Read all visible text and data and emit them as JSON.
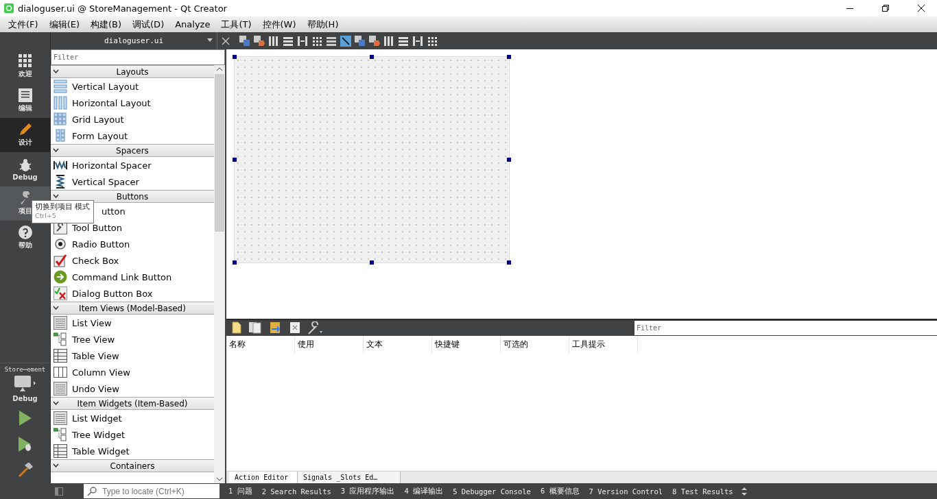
{
  "window": {
    "title": "dialoguser.ui @ StoreManagement - Qt Creator"
  },
  "menu": [
    "文件(F)",
    "编辑(E)",
    "构建(B)",
    "调试(D)",
    "Analyze",
    "工具(T)",
    "控件(W)",
    "帮助(H)"
  ],
  "editor_bar": {
    "file": "dialoguser.ui"
  },
  "modes": [
    {
      "label": "欢迎",
      "selected": false,
      "hovered": false
    },
    {
      "label": "编辑",
      "selected": false,
      "hovered": false
    },
    {
      "label": "设计",
      "selected": true,
      "hovered": false
    },
    {
      "label": "Debug",
      "selected": false,
      "hovered": false
    },
    {
      "label": "项目",
      "selected": false,
      "hovered": true
    },
    {
      "label": "帮助",
      "selected": false,
      "hovered": false
    }
  ],
  "target": {
    "project": "Store⋯ement",
    "config": "Debug"
  },
  "tooltip": {
    "title": "切换到项目 模式",
    "shortcut": "Ctrl+5"
  },
  "widget_box": {
    "filter_placeholder": "Filter",
    "groups": [
      {
        "title": "Layouts",
        "items": [
          {
            "label": "Vertical Layout"
          },
          {
            "label": "Horizontal Layout"
          },
          {
            "label": "Grid Layout"
          },
          {
            "label": "Form Layout"
          }
        ]
      },
      {
        "title": "Spacers",
        "items": [
          {
            "label": "Horizontal Spacer"
          },
          {
            "label": "Vertical Spacer"
          }
        ]
      },
      {
        "title": "Buttons",
        "items": [
          {
            "label": "utton",
            "kind": "covered"
          },
          {
            "label": "Tool Button"
          },
          {
            "label": "Radio Button"
          },
          {
            "label": "Check Box"
          },
          {
            "label": "Command Link Button"
          },
          {
            "label": "Dialog Button Box"
          }
        ]
      },
      {
        "title": "Item Views (Model-Based)",
        "items": [
          {
            "label": "List View"
          },
          {
            "label": "Tree View"
          },
          {
            "label": "Table View"
          },
          {
            "label": "Column View"
          },
          {
            "label": "Undo View"
          }
        ]
      },
      {
        "title": "Item Widgets (Item-Based)",
        "items": [
          {
            "label": "List Widget"
          },
          {
            "label": "Tree Widget"
          },
          {
            "label": "Table Widget"
          }
        ]
      },
      {
        "title": "Containers"
      }
    ]
  },
  "action_editor": {
    "filter_placeholder": "Filter",
    "columns": [
      "名称",
      "使用",
      "文本",
      "快捷键",
      "可选的",
      "工具提示"
    ],
    "tabs": [
      {
        "label": "Action Editor",
        "selected": true
      },
      {
        "label": "Signals _Slots Ed…",
        "selected": false
      }
    ]
  },
  "status_bar": {
    "locate_placeholder": "Type to locate (Ctrl+K)",
    "panes": [
      "1 问题",
      "2 Search Results",
      "3 应用程序输出",
      "4 编译输出",
      "5 Debugger Console",
      "6 概要信息",
      "7 Version Control",
      "8 Test Results"
    ]
  }
}
